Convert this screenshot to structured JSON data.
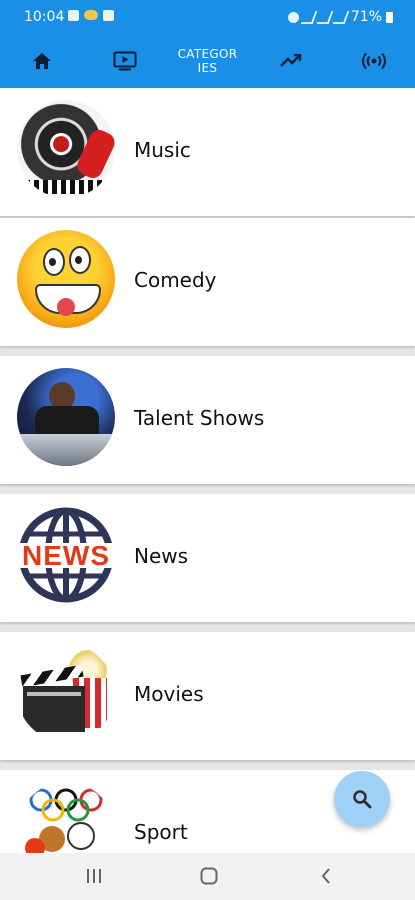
{
  "status_bar": {
    "time": "10:04",
    "battery": "71%"
  },
  "tabs": [
    {
      "icon": "home-icon"
    },
    {
      "icon": "tv-icon"
    },
    {
      "label": "CATEGORIES",
      "active": true
    },
    {
      "icon": "trending-icon"
    },
    {
      "icon": "live-broadcast-icon"
    }
  ],
  "categories": [
    {
      "name": "Music"
    },
    {
      "name": "Comedy"
    },
    {
      "name": "Talent Shows"
    },
    {
      "name": "News"
    },
    {
      "name": "Movies"
    },
    {
      "name": "Sport"
    }
  ],
  "news_logo_text": "NEWS",
  "fab": {
    "icon": "search-icon"
  },
  "nav": {
    "recents": "recents-icon",
    "home": "home-nav-icon",
    "back": "back-icon"
  },
  "colors": {
    "accent": "#1a8fe8",
    "fab": "#9fd0f6"
  }
}
